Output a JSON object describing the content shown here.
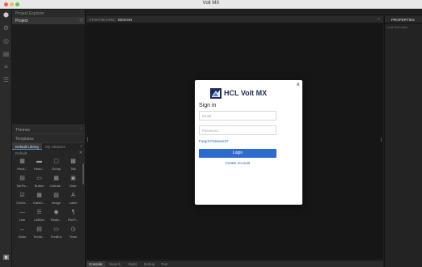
{
  "window": {
    "title": "Volt MX"
  },
  "rail": {
    "icons": [
      "hexagon-icon",
      "gear-icon",
      "circle-icon",
      "layers-icon",
      "list-icon",
      "stack-icon",
      "panel-icon"
    ]
  },
  "left_panel": {
    "header": "Project Explorer",
    "project_label": "Project",
    "themes_label": "Themes",
    "templates_label": "Templates",
    "tabs": [
      "Default Library",
      "My Libraries"
    ],
    "default_label": "Default",
    "widgets": [
      {
        "label": "Hmst...",
        "icon": "grid-icon"
      },
      {
        "label": "Head...",
        "icon": "header-icon"
      },
      {
        "label": "Group",
        "icon": "group-icon"
      },
      {
        "label": "Tab",
        "icon": "tab-icon"
      },
      {
        "label": "TabPa...",
        "icon": "tabpane-icon"
      },
      {
        "label": "Button",
        "icon": "button-icon"
      },
      {
        "label": "Calend...",
        "icon": "calendar-icon"
      },
      {
        "label": "Date",
        "icon": "date-icon"
      },
      {
        "label": "Check...",
        "icon": "checkbox-icon"
      },
      {
        "label": "DataG...",
        "icon": "datagrid-icon"
      },
      {
        "label": "Image",
        "icon": "image-icon"
      },
      {
        "label": "Label",
        "icon": "label-icon"
      },
      {
        "label": "Line",
        "icon": "line-icon"
      },
      {
        "label": "ListBox",
        "icon": "listbox-icon"
      },
      {
        "label": "Radio...",
        "icon": "radio-icon"
      },
      {
        "label": "RichT...",
        "icon": "richtext-icon"
      },
      {
        "label": "Slider",
        "icon": "slider-icon"
      },
      {
        "label": "TextAr...",
        "icon": "textarea-icon"
      },
      {
        "label": "TextBox",
        "icon": "textbox-icon"
      },
      {
        "label": "Timer",
        "icon": "timer-icon"
      }
    ]
  },
  "canvas": {
    "tabs": [
      "STORYBOARD",
      "DESIGN"
    ],
    "active_tab": "DESIGN"
  },
  "right_panel": {
    "header": "PROPERTIES",
    "tabs": "Look  Skin  Actn"
  },
  "bottom_bar": {
    "tabs": [
      "Console",
      "Search",
      "Build",
      "Debug",
      "Test"
    ],
    "active_tab": "Console"
  },
  "modal": {
    "brand": "HCL Volt MX",
    "title": "Sign in",
    "email_placeholder": "Email",
    "password_placeholder": "Password",
    "forgot_label": "Forgot Password?",
    "login_label": "Login",
    "create_label": "Create Account",
    "close_label": "×"
  },
  "colors": {
    "accent": "#2d6bcf",
    "brand": "#1f2c55",
    "link": "#1e5fbf"
  }
}
